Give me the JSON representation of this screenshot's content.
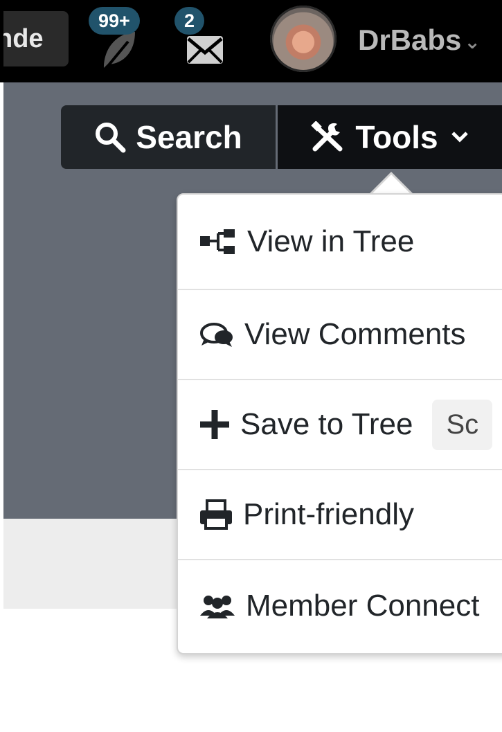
{
  "topbar": {
    "nav_partial_label": "nde",
    "notifications": {
      "badge": "99+"
    },
    "messages": {
      "badge": "2"
    },
    "user": {
      "name": "DrBabs",
      "caret": "⌄"
    }
  },
  "actions": {
    "search_label": "Search",
    "tools_label": "Tools"
  },
  "tools_menu": {
    "items": [
      {
        "label": "View in Tree",
        "icon": "tree-icon"
      },
      {
        "label": "View Comments",
        "icon": "comments-icon"
      },
      {
        "label": "Save to Tree",
        "icon": "plus-icon",
        "chip": "Sc"
      },
      {
        "label": "Print-friendly",
        "icon": "print-icon"
      },
      {
        "label": "Member Connect",
        "icon": "members-icon"
      }
    ]
  },
  "colors": {
    "topbar_bg": "#000000",
    "hero_bg": "#656b75",
    "badge_bg": "#21536b",
    "search_btn_bg": "#212529",
    "tools_btn_bg": "#0e1013"
  }
}
